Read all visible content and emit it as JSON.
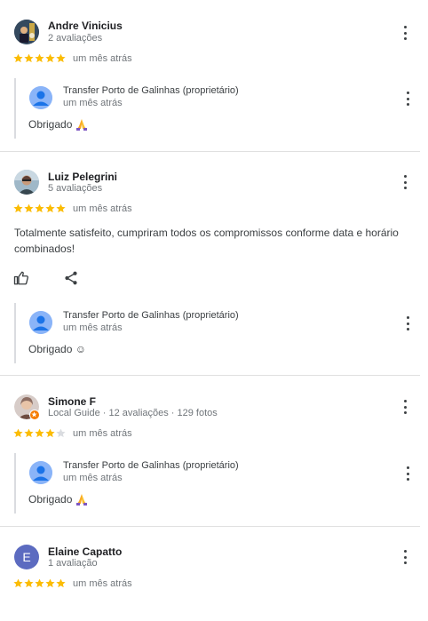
{
  "reviews": [
    {
      "name": "Andre Vinicius",
      "meta": "2 avaliações",
      "rating": 5,
      "date": "um mês atrás",
      "reply": {
        "owner": "Transfer Porto de Galinhas (proprietário)",
        "date": "um mês atrás",
        "text": "Obrigado"
      }
    },
    {
      "name": "Luiz Pelegrini",
      "meta": "5 avaliações",
      "rating": 5,
      "date": "um mês atrás",
      "text": "Totalmente satisfeito, cumpriram todos os compromissos conforme data e horário combinados!",
      "reply": {
        "owner": "Transfer Porto de Galinhas (proprietário)",
        "date": "um mês atrás",
        "text": "Obrigado ☺"
      }
    },
    {
      "name": "Simone F",
      "meta": "Local Guide · 12 avaliações · 129 fotos",
      "rating": 4,
      "date": "um mês atrás",
      "reply": {
        "owner": "Transfer Porto de Galinhas (proprietário)",
        "date": "um mês atrás",
        "text": "Obrigado"
      }
    },
    {
      "name": "Elaine Capatto",
      "avatar_letter": "E",
      "meta": "1 avaliação",
      "rating": 5,
      "date": "um mês atrás"
    }
  ],
  "colors": {
    "star_filled": "#fbbc04",
    "star_empty": "#dadce0",
    "avatar_letter_bg": "#5c6bc0",
    "owner_avatar_bg": "#8ab4f8",
    "local_guide_badge": "#f57c00"
  },
  "icons": [
    "star-icon",
    "kebab-menu-icon",
    "thumbs-up-icon",
    "share-icon",
    "praying-hands-icon",
    "person-avatar-icon",
    "local-guide-badge-icon"
  ]
}
